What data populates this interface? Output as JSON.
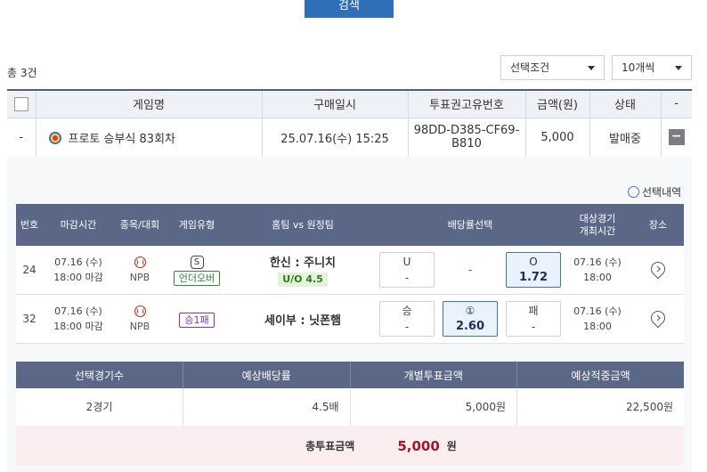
{
  "search": {
    "label": "검색"
  },
  "summary": {
    "total": "총 3건"
  },
  "filters": {
    "condition": "선택조건",
    "count": "10개씩"
  },
  "main_table": {
    "headers": [
      "게임명",
      "구매일시",
      "투표권고유번호",
      "금액(원)",
      "상태",
      "-"
    ],
    "row": {
      "index": "-",
      "game_name": "프로토 승부식 83회차",
      "purchase_time": "25.07.16(수) 15:25",
      "ticket_no": "98DD-D385-CF69-B810",
      "amount": "5,000",
      "status": "발매중",
      "toggle": "−"
    }
  },
  "selection_history": {
    "label": "선택내역"
  },
  "detail_table": {
    "headers": {
      "no": "번호",
      "deadline": "마감시간",
      "sport": "종목/대회",
      "type": "게임유형",
      "teams": "홈팀 vs 원정팀",
      "odds": "배당률선택",
      "match_time_1": "대상경기",
      "match_time_2": "개최시간",
      "venue": "장소"
    },
    "rows": [
      {
        "no": "24",
        "deadline_date": "07.16 (수)",
        "deadline_time": "18:00 마감",
        "league": "NPB",
        "type_symbol": "S",
        "type_label": "언더오버",
        "teams": "한신 : 주니치",
        "handicap": "U/O 4.5",
        "odds": [
          {
            "label": "U",
            "value": "-"
          },
          {
            "label": "-",
            "value": ""
          },
          {
            "label": "O",
            "value": "1.72"
          }
        ],
        "match_date": "07.16 (수)",
        "match_time": "18:00"
      },
      {
        "no": "32",
        "deadline_date": "07.16 (수)",
        "deadline_time": "18:00 마감",
        "league": "NPB",
        "type_label": "승1패",
        "teams": "세이부 : 닛폰햄",
        "odds": [
          {
            "label": "승",
            "value": "-"
          },
          {
            "label": "①",
            "value": "2.60"
          },
          {
            "label": "패",
            "value": "-"
          }
        ],
        "match_date": "07.16 (수)",
        "match_time": "18:00"
      }
    ]
  },
  "summary_table": {
    "headers": [
      "선택경기수",
      "예상배당률",
      "개별투표금액",
      "예상적중금액"
    ],
    "values": [
      "2경기",
      "4.5배",
      "5,000원",
      "22,500원"
    ]
  },
  "total_bet": {
    "label": "총투표금액",
    "value": "5,000",
    "unit": "원"
  }
}
